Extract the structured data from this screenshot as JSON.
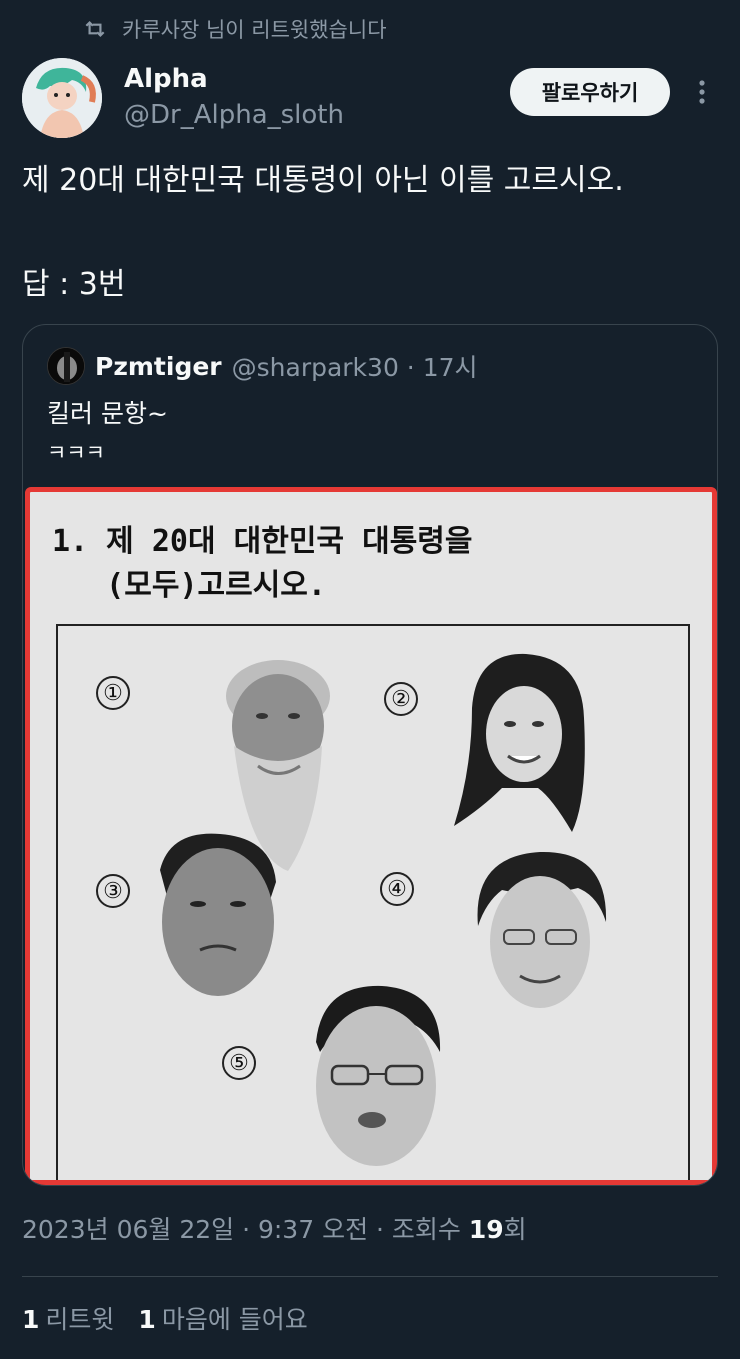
{
  "retweet": {
    "icon": "retweet-icon",
    "text": "카루사장 님이 리트윗했습니다"
  },
  "author": {
    "name": "Alpha",
    "handle": "@Dr_Alpha_sloth"
  },
  "follow_label": "팔로우하기",
  "tweet": {
    "line1": "제 20대 대한민국 대통령이 아닌 이를  고르시오.",
    "line2": "답 : 3번"
  },
  "quote": {
    "name": "Pzmtiger",
    "meta": "@sharpark30 · 17시",
    "text": "킬러 문항~",
    "sub": "ㅋㅋㅋ",
    "exam": {
      "line1": "1. 제 20대 대한민국 대통령을",
      "line2": "   (모두)고르시오.",
      "choices": [
        "①",
        "②",
        "③",
        "④",
        "⑤"
      ]
    }
  },
  "meta": {
    "date": "2023년 06월 22일 · 9:37 오전 · 조회수 ",
    "views": "19",
    "views_suffix": "회"
  },
  "stats": {
    "retweets": "1",
    "retweets_label": "리트윗",
    "likes": "1",
    "likes_label": "마음에 들어요"
  },
  "colors": {
    "background": "#15202b",
    "accent_border": "#e53935",
    "muted": "#8b98a5"
  }
}
